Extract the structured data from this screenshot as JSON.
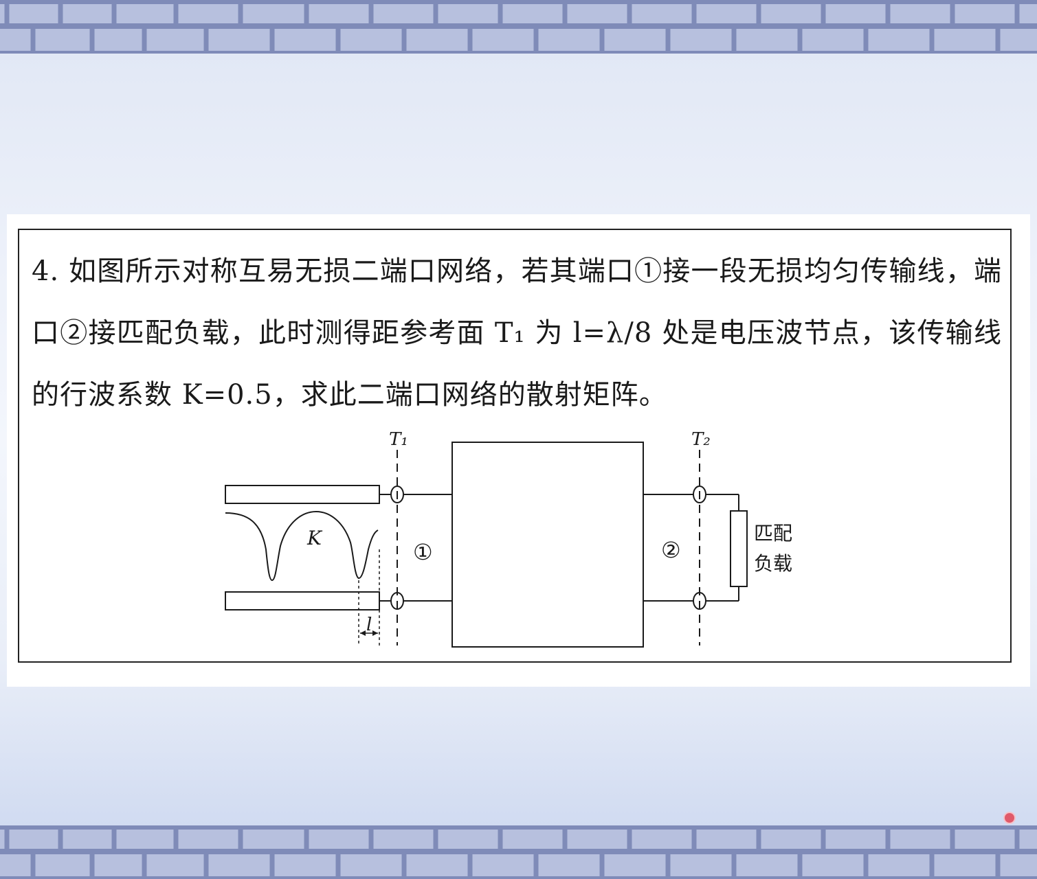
{
  "problem": {
    "text": "4. 如图所示对称互易无损二端口网络，若其端口①接一段无损均匀传输线，端口②接匹配负载，此时测得距参考面 T₁ 为 l=λ/8 处是电压波节点，该传输线的行波系数 K=0.5，求此二端口网络的散射矩阵。"
  },
  "diagram": {
    "labels": {
      "t1": "T₁",
      "t2": "T₂",
      "port1": "①",
      "port2": "②",
      "k": "K",
      "l": "l",
      "load_line1": "匹配",
      "load_line2": "负载"
    }
  },
  "colors": {
    "ink": "#1a1a1a",
    "brick_light": "#b7c0de",
    "brick_dark": "#7f8bb8",
    "background": "#edf1fa"
  }
}
